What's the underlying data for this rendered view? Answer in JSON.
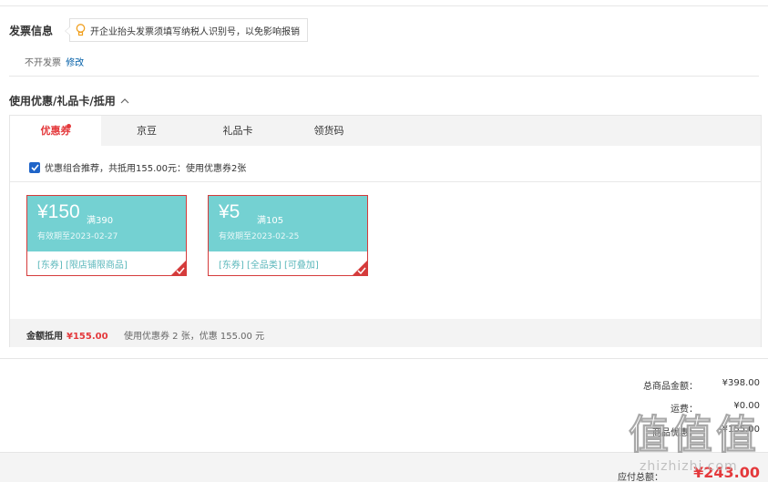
{
  "invoice": {
    "title": "发票信息",
    "tip": "开企业抬头发票须填写纳税人识别号，以免影响报销",
    "status": "不开发票",
    "edit_label": "修改"
  },
  "discount": {
    "title": "使用优惠/礼品卡/抵用",
    "tabs": [
      "优惠券",
      "京豆",
      "礼品卡",
      "领货码"
    ],
    "recommend_text": "优惠组合推荐，共抵用155.00元：使用优惠券2张",
    "coupons": [
      {
        "amount": "¥150",
        "condition": "满390",
        "expiry": "有效期至2023-02-27",
        "tags": "[东券] [限店铺限商品]"
      },
      {
        "amount": "¥5",
        "condition": "满105",
        "expiry": "有效期至2023-02-25",
        "tags": "[东券] [全品类] [可叠加]"
      }
    ],
    "summary_label": "金额抵用",
    "summary_value": "¥155.00",
    "summary_desc": "使用优惠券 2 张，优惠 155.00 元"
  },
  "totals": {
    "goods_label": "总商品金额：",
    "goods_value": "¥398.00",
    "shipping_label": "运费：",
    "shipping_value": "¥0.00",
    "discount_label": "商品优惠：",
    "discount_value": "-¥155.00",
    "payable_label": "应付总额：",
    "payable_value": "¥243.00"
  },
  "watermark": {
    "text": "值",
    "sub": "zhizhizhi.com"
  },
  "colors": {
    "accent": "#e4393c",
    "coupon": "#74d1d2",
    "link": "#005ea7",
    "checkbox": "#1f64c8"
  }
}
